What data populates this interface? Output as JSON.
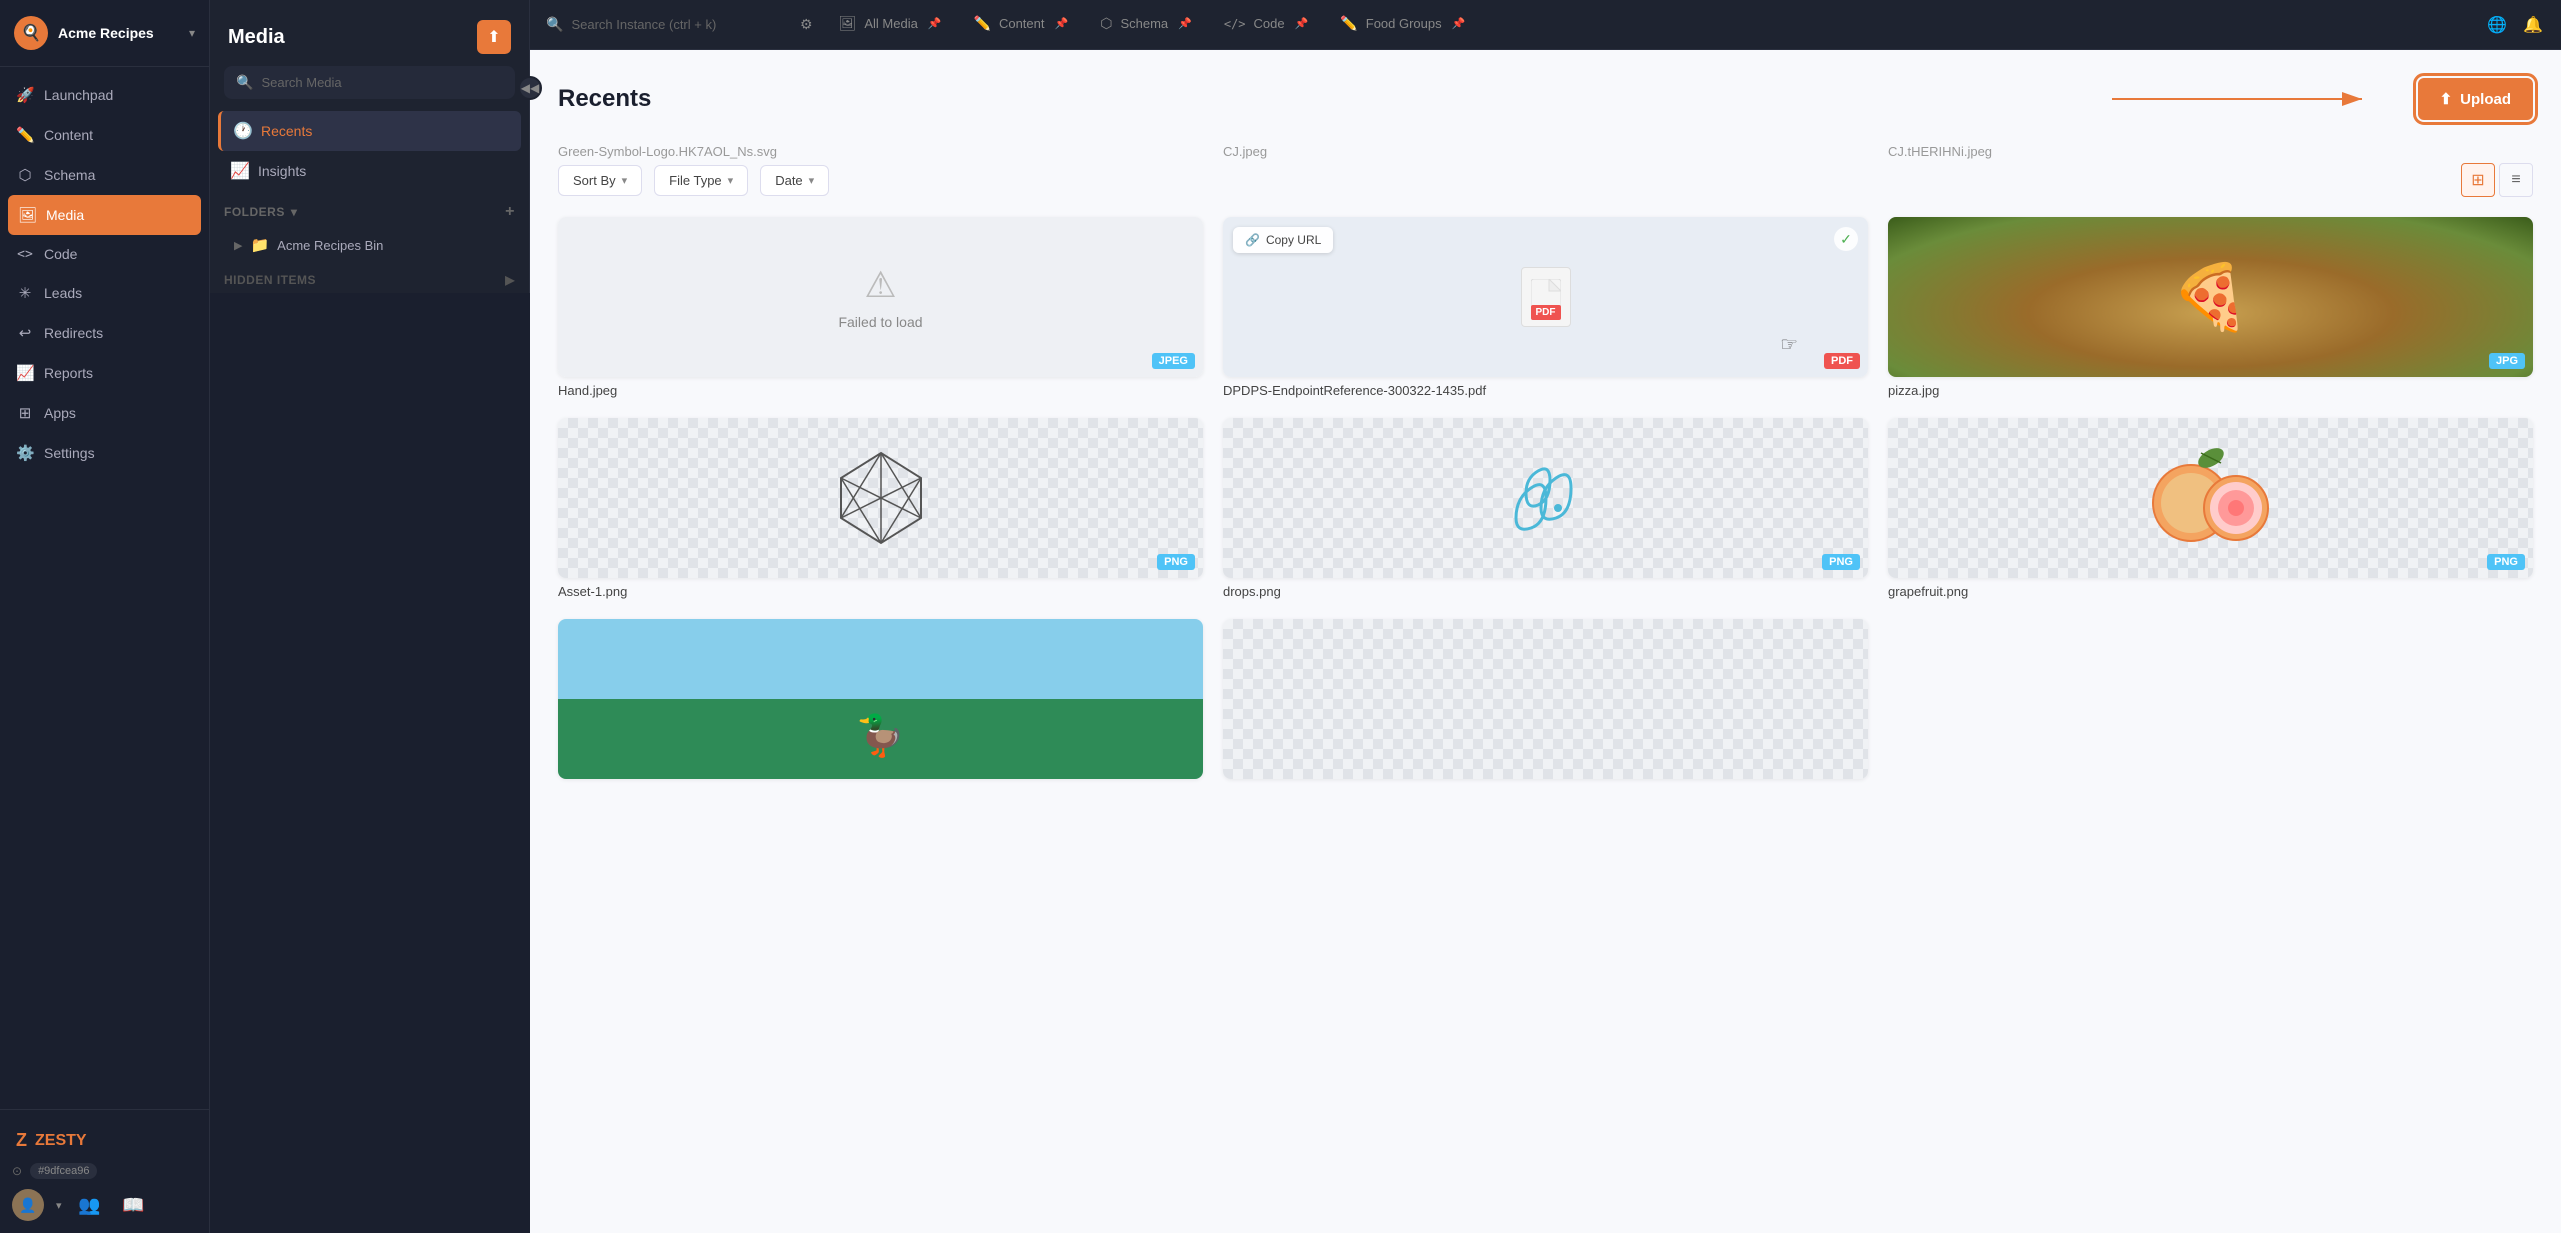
{
  "brand": {
    "logo": "🍳",
    "name": "Acme Recipes",
    "hash": "#9dfcea96"
  },
  "nav": {
    "items": [
      {
        "id": "launchpad",
        "icon": "🚀",
        "label": "Launchpad"
      },
      {
        "id": "content",
        "icon": "✏️",
        "label": "Content"
      },
      {
        "id": "schema",
        "icon": "⬡",
        "label": "Schema"
      },
      {
        "id": "media",
        "icon": "🖼",
        "label": "Media",
        "active": true
      },
      {
        "id": "code",
        "icon": "<>",
        "label": "Code"
      },
      {
        "id": "leads",
        "icon": "📊",
        "label": "Leads"
      },
      {
        "id": "redirects",
        "icon": "↩",
        "label": "Redirects"
      },
      {
        "id": "reports",
        "icon": "📈",
        "label": "Reports"
      },
      {
        "id": "apps",
        "icon": "🔲",
        "label": "Apps"
      },
      {
        "id": "settings",
        "icon": "⚙️",
        "label": "Settings"
      }
    ]
  },
  "media_sidebar": {
    "title": "Media",
    "search_placeholder": "Search Media",
    "nav_items": [
      {
        "id": "recents",
        "icon": "🕐",
        "label": "Recents",
        "active": true
      },
      {
        "id": "insights",
        "icon": "📈",
        "label": "Insights"
      }
    ],
    "folders_label": "FOLDERS",
    "folders": [
      {
        "name": "Acme Recipes Bin"
      }
    ],
    "hidden_items_label": "HIDDEN ITEMS"
  },
  "topbar": {
    "search_placeholder": "Search Instance (ctrl + k)",
    "tabs": [
      {
        "id": "all-media",
        "icon": "🖼",
        "label": "All Media",
        "pinned": true
      },
      {
        "id": "content",
        "icon": "✏️",
        "label": "Content",
        "pinned": true
      },
      {
        "id": "schema",
        "icon": "⬡",
        "label": "Schema",
        "pinned": true
      },
      {
        "id": "code",
        "icon": "</>",
        "label": "Code",
        "pinned": true
      },
      {
        "id": "food-groups",
        "icon": "✏️",
        "label": "Food Groups",
        "pinned": true
      }
    ]
  },
  "content": {
    "page_title": "Recents",
    "upload_label": "Upload",
    "filters": {
      "sort_by": "Sort By",
      "file_type": "File Type",
      "date": "Date"
    },
    "top_files": [
      {
        "name": "Green-Symbol-Logo.HK7AOL_Ns.svg"
      },
      {
        "name": "CJ.jpeg"
      },
      {
        "name": "CJ.tHERIHNi.jpeg"
      }
    ],
    "media_items": [
      {
        "id": "hand",
        "type": "failed",
        "badge": "JPEG",
        "badge_class": "jpeg",
        "name": "Hand.jpeg",
        "label": "Failed to load"
      },
      {
        "id": "dpdps",
        "type": "pdf",
        "badge": "PDF",
        "badge_class": "pdf",
        "name": "DPDPS-EndpointReference-300322-1435.pdf",
        "has_copy_url": true,
        "copy_url_label": "Copy URL"
      },
      {
        "id": "pizza",
        "type": "image",
        "badge": "JPG",
        "badge_class": "jpg",
        "name": "pizza.jpg"
      },
      {
        "id": "asset1",
        "type": "geo",
        "badge": "PNG",
        "badge_class": "png",
        "name": "Asset-1.png"
      },
      {
        "id": "drops",
        "type": "drops",
        "badge": "PNG",
        "badge_class": "png",
        "name": "drops.png"
      },
      {
        "id": "grapefruit",
        "type": "grapefruit",
        "badge": "PNG",
        "badge_class": "png",
        "name": "grapefruit.png"
      }
    ]
  }
}
